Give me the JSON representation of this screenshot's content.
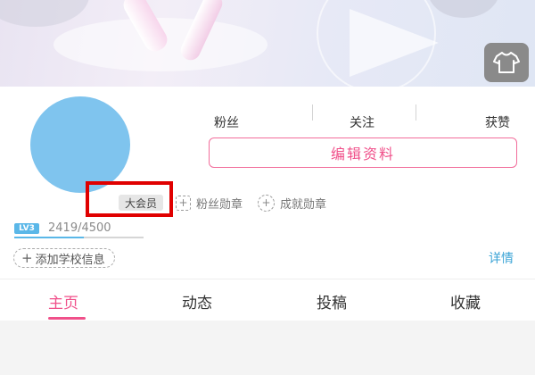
{
  "header": {
    "wardrobe_icon": "shirt-icon"
  },
  "stats": {
    "fans_label": "粉丝",
    "following_label": "关注",
    "likes_label": "获赞"
  },
  "actions": {
    "edit_profile": "编辑资料"
  },
  "badges": {
    "vip_label": "大会员",
    "fan_medal_label": "粉丝勋章",
    "achievement_medal_label": "成就勋章"
  },
  "level": {
    "tag": "LV3",
    "exp_text": "2419/4500",
    "progress": 0.54
  },
  "school": {
    "label": "添加学校信息"
  },
  "details_link": "详情",
  "tabs": [
    {
      "label": "主页",
      "active": true
    },
    {
      "label": "动态",
      "active": false
    },
    {
      "label": "投稿",
      "active": false
    },
    {
      "label": "收藏",
      "active": false
    }
  ],
  "colors": {
    "accent": "#f0508a",
    "link": "#3aa3d6",
    "avatar": "#7fc4ee",
    "highlight": "#e00000"
  }
}
